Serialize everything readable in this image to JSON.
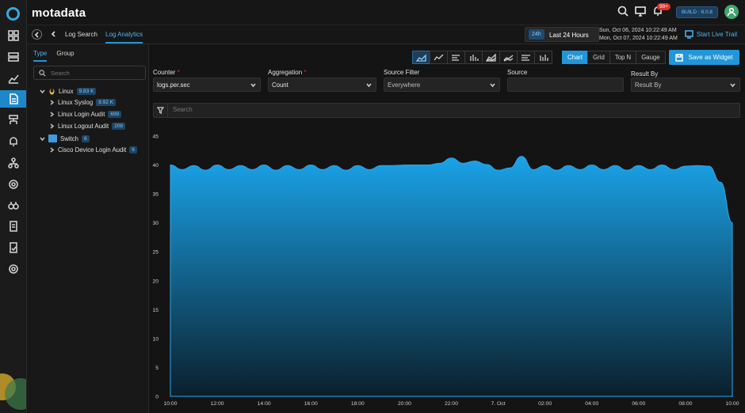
{
  "app": {
    "brand": "motadata",
    "build": "BUILD : 8.0.8",
    "notifications": "99+"
  },
  "nav": {
    "back_breadcrumb": "Log Search",
    "active_tab": "Log Analytics"
  },
  "time": {
    "badge": "24h",
    "label": "Last 24 Hours",
    "from": "Sun, Oct 06, 2024 10:22:49 AM",
    "to": "Mon, Oct 07, 2024 10:22:49 AM",
    "live_trail": "Start Live Trail"
  },
  "left": {
    "tabs": [
      "Type",
      "Group"
    ],
    "search_placeholder": "Search",
    "tree": [
      {
        "label": "Linux",
        "count": "9.83 K",
        "level": 0,
        "expanded": true,
        "icon": "linux-icon"
      },
      {
        "label": "Linux Syslog",
        "count": "8.92 K",
        "level": 1
      },
      {
        "label": "Linux Login Audit",
        "count": "699",
        "level": 1
      },
      {
        "label": "Linux Logout Audit",
        "count": "208",
        "level": 1
      },
      {
        "label": "Switch",
        "count": "6",
        "level": 0,
        "expanded": true,
        "icon": "switch-icon"
      },
      {
        "label": "Cisco Device Login Audit",
        "count": "6",
        "level": 1
      }
    ]
  },
  "toolbar": {
    "chart_types": [
      "area-chart-icon",
      "line-chart-icon",
      "horizontal-bar-icon",
      "vertical-bar-icon",
      "stacked-area-icon",
      "stacked-line-icon",
      "stacked-hbar-icon",
      "stacked-vbar-icon"
    ],
    "views": [
      "Chart",
      "Grid",
      "Top N",
      "Gauge"
    ],
    "active_view": "Chart",
    "save_label": "Save as Widget"
  },
  "filters": {
    "counter": {
      "label": "Counter",
      "value": "logs.per.sec"
    },
    "aggregation": {
      "label": "Aggregation",
      "value": "Count"
    },
    "source_filter": {
      "label": "Source Filter",
      "value": "Everywhere"
    },
    "source": {
      "label": "Source",
      "value": ""
    },
    "result_by": {
      "label": "Result By",
      "placeholder": "Result By"
    },
    "search_placeholder": "Search"
  },
  "colors": {
    "accent": "#2196d9",
    "area_top": "#1aa3e8",
    "area_bottom": "#0b1f2c"
  },
  "chart_data": {
    "type": "area",
    "ylim": [
      0,
      45
    ],
    "yticks": [
      0,
      5,
      10,
      15,
      20,
      25,
      30,
      35,
      40,
      45
    ],
    "xticks": [
      "10:00",
      "12:00",
      "14:00",
      "16:00",
      "18:00",
      "20:00",
      "22:00",
      "7. Oct",
      "02:00",
      "04:00",
      "06:00",
      "08:00",
      "10:00"
    ],
    "x_hours": [
      0,
      0.5,
      1,
      1.5,
      2,
      2.5,
      3,
      3.5,
      4,
      4.5,
      5,
      5.5,
      6,
      6.5,
      7,
      7.5,
      8,
      8.5,
      9,
      9.5,
      10,
      10.5,
      11,
      11.5,
      12,
      12.5,
      13,
      13.5,
      14,
      14.5,
      15,
      15.5,
      16,
      16.5,
      17,
      17.5,
      18,
      18.5,
      19,
      19.5,
      20,
      20.5,
      21,
      21.5,
      22,
      22.5,
      23,
      23.5,
      24
    ],
    "values": [
      40,
      39.2,
      39.9,
      39.1,
      40,
      39.2,
      39.9,
      39.2,
      40,
      39.1,
      39.9,
      39.2,
      40,
      39.2,
      39.9,
      39.1,
      39.9,
      39.2,
      39.9,
      39.9,
      40,
      40,
      40,
      40.3,
      41.2,
      40.3,
      40.7,
      40.1,
      39.1,
      39.5,
      41.5,
      39.2,
      39.9,
      39.1,
      39.9,
      39.2,
      40,
      39.2,
      39.9,
      39.1,
      39.9,
      39.2,
      40,
      39.2,
      39.8,
      39.9,
      39.8,
      37,
      30
    ]
  }
}
